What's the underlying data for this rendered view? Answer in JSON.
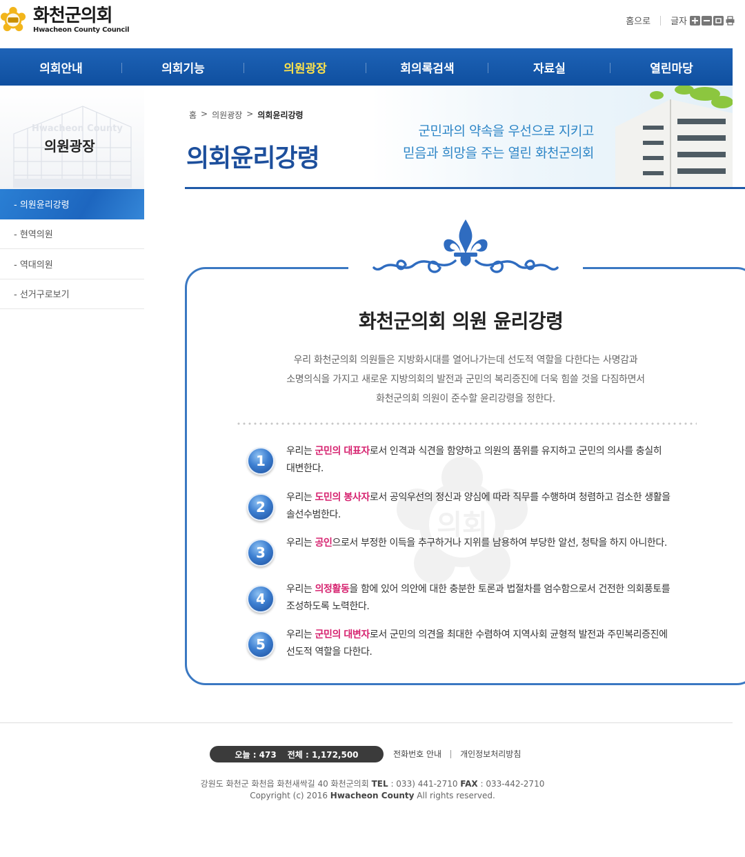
{
  "header": {
    "logo_ko": "화천군의회",
    "logo_en": "Hwacheon County Council",
    "util_home": "홈으로",
    "util_font": "글자"
  },
  "gnb": {
    "items": [
      {
        "label": "의회안내"
      },
      {
        "label": "의회기능"
      },
      {
        "label": "의원광장"
      },
      {
        "label": "회의록검색"
      },
      {
        "label": "자료실"
      },
      {
        "label": "열린마당"
      }
    ],
    "active_index": 2
  },
  "side": {
    "visual_en": "Hwacheon County",
    "visual_title": "의원광장"
  },
  "lnb": {
    "items": [
      {
        "label": "- 의원윤리강령"
      },
      {
        "label": "- 현역의원"
      },
      {
        "label": "- 역대의원"
      },
      {
        "label": "- 선거구로보기"
      }
    ],
    "active_index": 0
  },
  "breadcrumb": {
    "home": "홈",
    "sep": ">",
    "level1": "의원광장",
    "current": "의회윤리강령"
  },
  "page": {
    "title": "의회윤리강령",
    "slogan_line1": "군민과의 약속을 우선으로 지키고",
    "slogan_line2": "믿음과 희망을 주는 열린 화천군의회"
  },
  "ethics": {
    "title": "화천군의회 의원 윤리강령",
    "intro_lines": [
      "우리 화천군의회 의원들은 지방화시대를 열어나가는데 선도적 역할을 다한다는 사명감과",
      "소명의식을 가지고 새로운 지방의회의 발전과 군민의 복리증진에 더욱 힘쓸 것을 다짐하면서",
      "화천군의회 의원이 준수할 윤리강령을 정한다."
    ],
    "items": [
      {
        "num": "1",
        "pre": "우리는 ",
        "hl": "군민의 대표자",
        "post": "로서 인격과 식견을 함양하고 의원의 품위를 유지하고 군민의 의사를 충실히 대변한다."
      },
      {
        "num": "2",
        "pre": "우리는 ",
        "hl": "도민의 봉사자",
        "post": "로서 공익우선의 정신과 양심에 따라 직무를 수행하며 청렴하고 검소한 생활을 솔선수범한다."
      },
      {
        "num": "3",
        "pre": "우리는 ",
        "hl": "공인",
        "post": "으로서 부정한 이득을 추구하거나 지위를 남용하여 부당한 알선, 청탁을 하지 아니한다."
      },
      {
        "num": "4",
        "pre": "우리는 ",
        "hl": "의정활동",
        "post": "을 함에 있어 의안에 대한 충분한 토론과 법절차를 엄수함으로서 건전한 의회풍토를 조성하도록 노력한다."
      },
      {
        "num": "5",
        "pre": "우리는 ",
        "hl": "군민의 대변자",
        "post": "로서 군민의 의견을 최대한 수렴하여 지역사회 균형적 발전과 주민복리증진에 선도적 역할을 다한다."
      }
    ],
    "watermark": "의회"
  },
  "footer": {
    "today_label": "오늘 : 473",
    "total_label": "전체 : 1,172,500",
    "link_phone": "전화번호 안내",
    "link_privacy": "개인정보처리방침",
    "address_pre": "강원도 화천군 화천읍 화천새싹길 40 화천군의회",
    "tel_label": "TEL",
    "tel_value": " : 033) 441-2710 ",
    "fax_label": "FAX",
    "fax_value": " : 033-442-2710",
    "copy_pre": "Copyright (c) 2016 ",
    "copy_bold": "Hwacheon County",
    "copy_post": " All rights reserved."
  },
  "colors": {
    "brand_blue": "#1d4f9c",
    "nav_active": "#ffe34a",
    "highlight": "#d6226f"
  }
}
